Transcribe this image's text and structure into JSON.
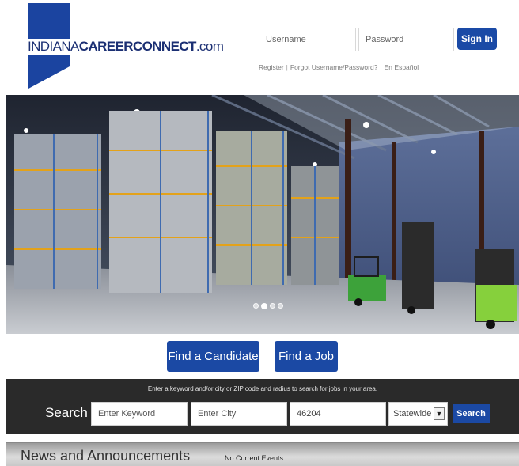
{
  "brand": {
    "logo_part1": "INDIANA",
    "logo_part2": "CAREERCONNECT",
    "logo_part3": ".com",
    "color": "#1b2f73"
  },
  "login": {
    "username_placeholder": "Username",
    "password_placeholder": "Password",
    "signin_label": "Sign In",
    "register_link": "Register",
    "forgot_link": "Forgot Username/Password?",
    "spanish_link": "En Español",
    "separator": "|"
  },
  "hero": {
    "dots": 4,
    "active_dot": 1
  },
  "cta": {
    "find_candidate": "Find a Candidate",
    "find_job": "Find a Job"
  },
  "search": {
    "hint": "Enter a keyword and/or city or ZIP code and radius to search for jobs in your area.",
    "label": "Search",
    "keyword_placeholder": "Enter Keyword",
    "city_placeholder": "Enter City",
    "zip_value": "46204",
    "radius_selected": "Statewide",
    "button_label": "Search"
  },
  "news": {
    "title": "News and Announcements",
    "status": "No Current Events"
  },
  "colors": {
    "accent": "#1b49a4",
    "search_band": "#2a2a2a"
  },
  "icons": {
    "select_arrow": "chevron-down-icon"
  }
}
